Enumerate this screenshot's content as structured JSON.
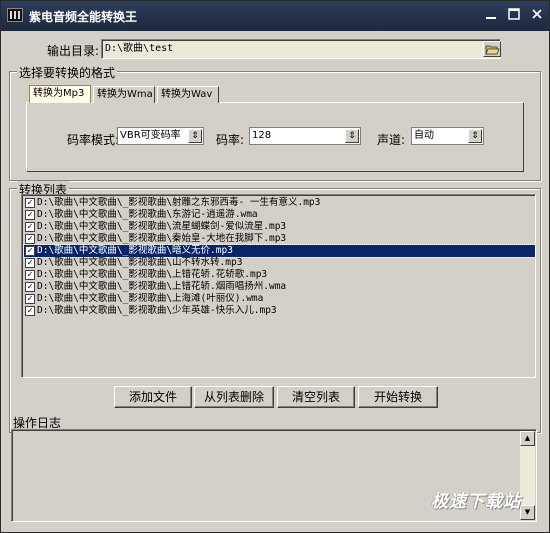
{
  "window": {
    "title": "紫电音频全能转换王",
    "min_icon": "minimize-icon",
    "max_icon": "maximize-icon",
    "close_icon": "close-icon"
  },
  "output": {
    "label": "输出目录:",
    "value": "D:\\歌曲\\test",
    "browse_icon": "folder-open-icon"
  },
  "format_group": {
    "title": "选择要转换的格式",
    "tabs": [
      {
        "label": "转换为Mp3",
        "active": true
      },
      {
        "label": "转换为Wma",
        "active": false
      },
      {
        "label": "转换为Wav",
        "active": false
      }
    ],
    "mode_label": "码率模式:",
    "mode_value": "VBR可变码率",
    "bitrate_label": "码率:",
    "bitrate_value": "128",
    "channel_label": "声道:",
    "channel_value": "自动"
  },
  "list_group": {
    "title": "转换列表",
    "items": [
      {
        "text": "D:\\歌曲\\中文歌曲\\_影视歌曲\\射雕之东邪西毒- 一生有意义.mp3",
        "checked": true,
        "selected": false
      },
      {
        "text": "D:\\歌曲\\中文歌曲\\_影视歌曲\\东游记-逍遥游.wma",
        "checked": true,
        "selected": false
      },
      {
        "text": "D:\\歌曲\\中文歌曲\\_影视歌曲\\流星蝴蝶剑-爱似流星.mp3",
        "checked": true,
        "selected": false
      },
      {
        "text": "D:\\歌曲\\中文歌曲\\_影视歌曲\\秦始皇-大地在我脚下.mp3",
        "checked": true,
        "selected": false
      },
      {
        "text": "D:\\歌曲\\中文歌曲\\_影视歌曲\\暗义无价.mp3",
        "checked": true,
        "selected": true
      },
      {
        "text": "D:\\歌曲\\中文歌曲\\_影视歌曲\\山不转水转.mp3",
        "checked": true,
        "selected": false
      },
      {
        "text": "D:\\歌曲\\中文歌曲\\_影视歌曲\\上错花轿.花轿歌.mp3",
        "checked": true,
        "selected": false
      },
      {
        "text": "D:\\歌曲\\中文歌曲\\_影视歌曲\\上错花轿.烟雨唱扬州.wma",
        "checked": true,
        "selected": false
      },
      {
        "text": "D:\\歌曲\\中文歌曲\\_影视歌曲\\上海滩(叶丽仪).wma",
        "checked": true,
        "selected": false
      },
      {
        "text": "D:\\歌曲\\中文歌曲\\_影视歌曲\\少年英雄-快乐入儿.mp3",
        "checked": true,
        "selected": false
      }
    ]
  },
  "actions": {
    "add": "添加文件",
    "remove": "从列表删除",
    "clear": "清空列表",
    "start": "开始转换"
  },
  "log": {
    "title": "操作日志",
    "scroll_up_icon": "scroll-up-arrow-icon",
    "scroll_down_icon": "scroll-down-arrow-icon"
  },
  "watermark": "极速下载站"
}
